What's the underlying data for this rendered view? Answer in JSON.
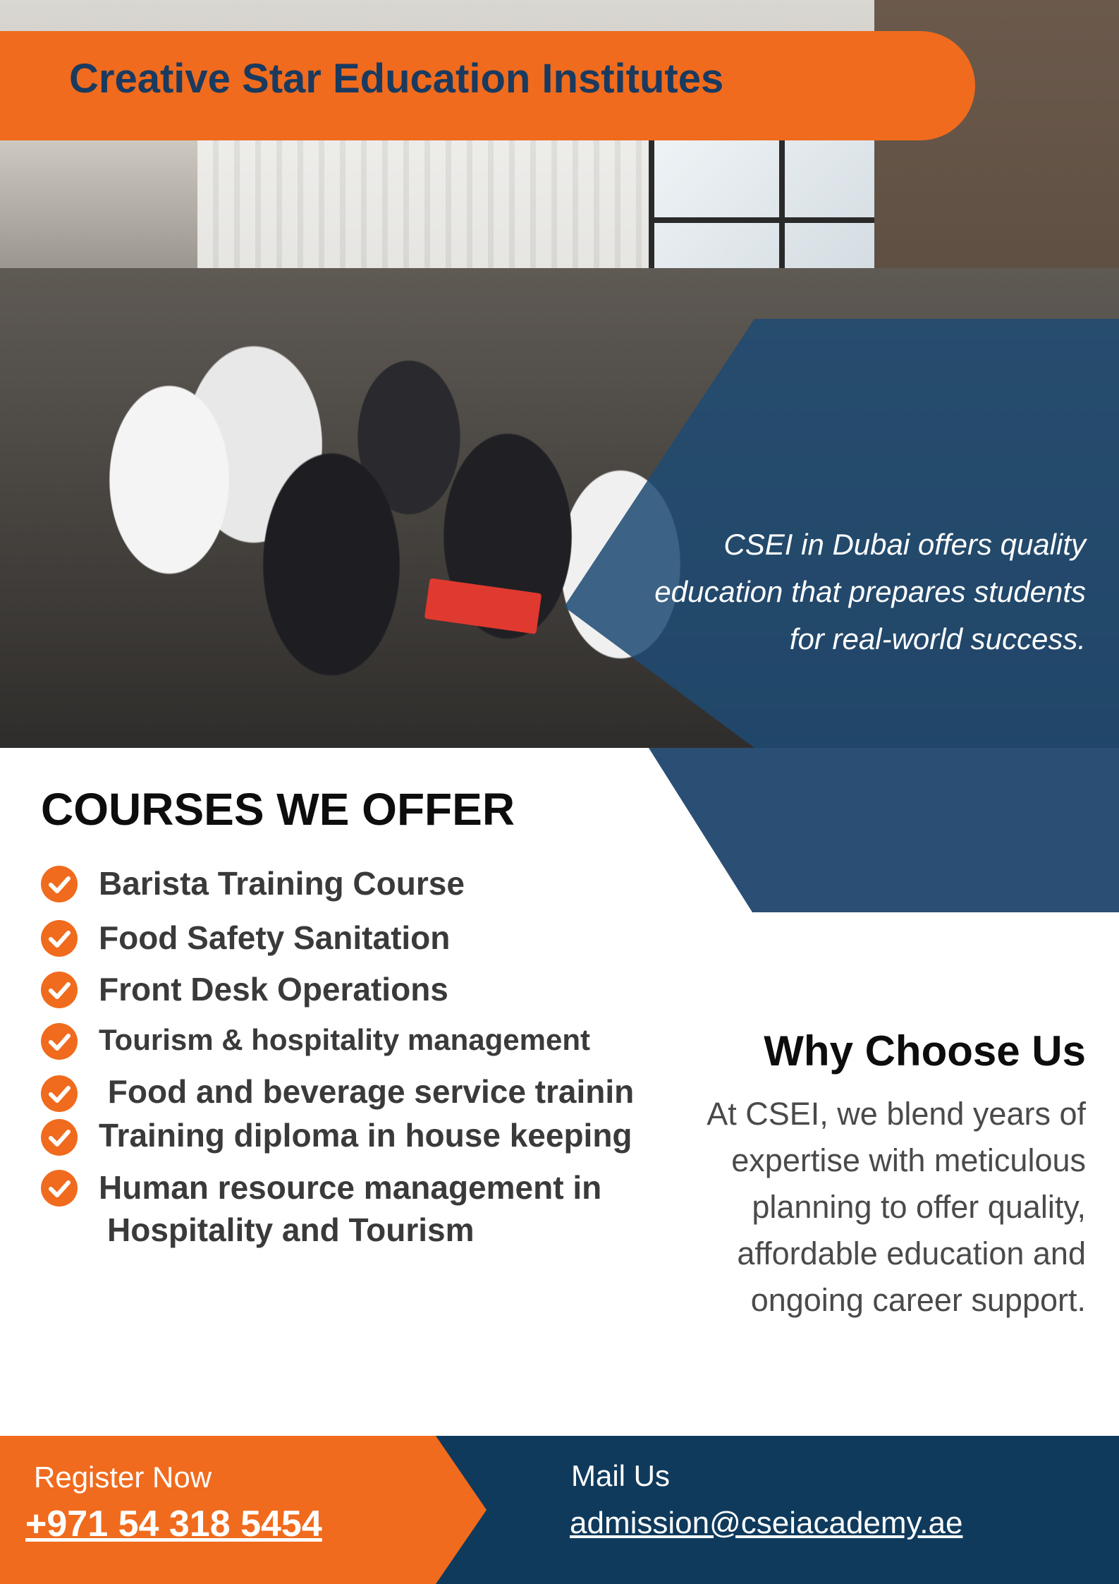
{
  "brand": {
    "title": "Creative Star Education Institutes",
    "orange": "#f06b1d",
    "navy": "#1a3a5f",
    "panel_blue": "#1e4a73"
  },
  "hero": {
    "tagline": "CSEI in Dubai offers quality education that prepares students for real-world success."
  },
  "courses": {
    "heading": "COURSES WE OFFER",
    "check_icon": "orange-check-circle-icon",
    "items": [
      {
        "label": "Barista Training Course"
      },
      {
        "label": "Food Safety Sanitation"
      },
      {
        "label": "Front Desk Operations"
      },
      {
        "label": "Tourism & hospitality management"
      },
      {
        "label": " Food and beverage service trainin"
      },
      {
        "label": "Training diploma in house keeping"
      },
      {
        "label": "Human resource management in",
        "label_line2": "Hospitality and Tourism"
      }
    ]
  },
  "why": {
    "heading": "Why Choose Us",
    "text": "At CSEI, we blend years of expertise with meticulous planning to offer quality, affordable education and ongoing career support."
  },
  "footer": {
    "register_label": "Register Now",
    "phone": "+971 54 318 5454",
    "mail_label": "Mail Us",
    "email": "admission@cseiacademy.ae"
  }
}
